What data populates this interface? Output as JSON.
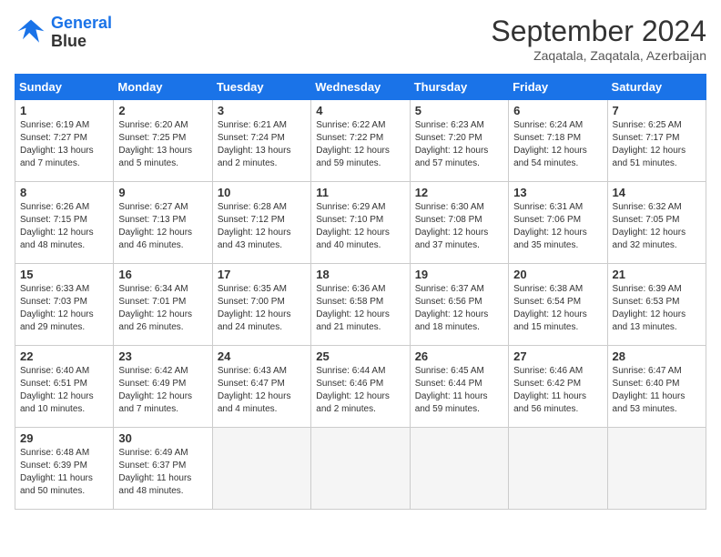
{
  "logo": {
    "line1": "General",
    "line2": "Blue"
  },
  "header": {
    "month": "September 2024",
    "location": "Zaqatala, Zaqatala, Azerbaijan"
  },
  "weekdays": [
    "Sunday",
    "Monday",
    "Tuesday",
    "Wednesday",
    "Thursday",
    "Friday",
    "Saturday"
  ],
  "weeks": [
    [
      {
        "day": "1",
        "info": "Sunrise: 6:19 AM\nSunset: 7:27 PM\nDaylight: 13 hours\nand 7 minutes."
      },
      {
        "day": "2",
        "info": "Sunrise: 6:20 AM\nSunset: 7:25 PM\nDaylight: 13 hours\nand 5 minutes."
      },
      {
        "day": "3",
        "info": "Sunrise: 6:21 AM\nSunset: 7:24 PM\nDaylight: 13 hours\nand 2 minutes."
      },
      {
        "day": "4",
        "info": "Sunrise: 6:22 AM\nSunset: 7:22 PM\nDaylight: 12 hours\nand 59 minutes."
      },
      {
        "day": "5",
        "info": "Sunrise: 6:23 AM\nSunset: 7:20 PM\nDaylight: 12 hours\nand 57 minutes."
      },
      {
        "day": "6",
        "info": "Sunrise: 6:24 AM\nSunset: 7:18 PM\nDaylight: 12 hours\nand 54 minutes."
      },
      {
        "day": "7",
        "info": "Sunrise: 6:25 AM\nSunset: 7:17 PM\nDaylight: 12 hours\nand 51 minutes."
      }
    ],
    [
      {
        "day": "8",
        "info": "Sunrise: 6:26 AM\nSunset: 7:15 PM\nDaylight: 12 hours\nand 48 minutes."
      },
      {
        "day": "9",
        "info": "Sunrise: 6:27 AM\nSunset: 7:13 PM\nDaylight: 12 hours\nand 46 minutes."
      },
      {
        "day": "10",
        "info": "Sunrise: 6:28 AM\nSunset: 7:12 PM\nDaylight: 12 hours\nand 43 minutes."
      },
      {
        "day": "11",
        "info": "Sunrise: 6:29 AM\nSunset: 7:10 PM\nDaylight: 12 hours\nand 40 minutes."
      },
      {
        "day": "12",
        "info": "Sunrise: 6:30 AM\nSunset: 7:08 PM\nDaylight: 12 hours\nand 37 minutes."
      },
      {
        "day": "13",
        "info": "Sunrise: 6:31 AM\nSunset: 7:06 PM\nDaylight: 12 hours\nand 35 minutes."
      },
      {
        "day": "14",
        "info": "Sunrise: 6:32 AM\nSunset: 7:05 PM\nDaylight: 12 hours\nand 32 minutes."
      }
    ],
    [
      {
        "day": "15",
        "info": "Sunrise: 6:33 AM\nSunset: 7:03 PM\nDaylight: 12 hours\nand 29 minutes."
      },
      {
        "day": "16",
        "info": "Sunrise: 6:34 AM\nSunset: 7:01 PM\nDaylight: 12 hours\nand 26 minutes."
      },
      {
        "day": "17",
        "info": "Sunrise: 6:35 AM\nSunset: 7:00 PM\nDaylight: 12 hours\nand 24 minutes."
      },
      {
        "day": "18",
        "info": "Sunrise: 6:36 AM\nSunset: 6:58 PM\nDaylight: 12 hours\nand 21 minutes."
      },
      {
        "day": "19",
        "info": "Sunrise: 6:37 AM\nSunset: 6:56 PM\nDaylight: 12 hours\nand 18 minutes."
      },
      {
        "day": "20",
        "info": "Sunrise: 6:38 AM\nSunset: 6:54 PM\nDaylight: 12 hours\nand 15 minutes."
      },
      {
        "day": "21",
        "info": "Sunrise: 6:39 AM\nSunset: 6:53 PM\nDaylight: 12 hours\nand 13 minutes."
      }
    ],
    [
      {
        "day": "22",
        "info": "Sunrise: 6:40 AM\nSunset: 6:51 PM\nDaylight: 12 hours\nand 10 minutes."
      },
      {
        "day": "23",
        "info": "Sunrise: 6:42 AM\nSunset: 6:49 PM\nDaylight: 12 hours\nand 7 minutes."
      },
      {
        "day": "24",
        "info": "Sunrise: 6:43 AM\nSunset: 6:47 PM\nDaylight: 12 hours\nand 4 minutes."
      },
      {
        "day": "25",
        "info": "Sunrise: 6:44 AM\nSunset: 6:46 PM\nDaylight: 12 hours\nand 2 minutes."
      },
      {
        "day": "26",
        "info": "Sunrise: 6:45 AM\nSunset: 6:44 PM\nDaylight: 11 hours\nand 59 minutes."
      },
      {
        "day": "27",
        "info": "Sunrise: 6:46 AM\nSunset: 6:42 PM\nDaylight: 11 hours\nand 56 minutes."
      },
      {
        "day": "28",
        "info": "Sunrise: 6:47 AM\nSunset: 6:40 PM\nDaylight: 11 hours\nand 53 minutes."
      }
    ],
    [
      {
        "day": "29",
        "info": "Sunrise: 6:48 AM\nSunset: 6:39 PM\nDaylight: 11 hours\nand 50 minutes."
      },
      {
        "day": "30",
        "info": "Sunrise: 6:49 AM\nSunset: 6:37 PM\nDaylight: 11 hours\nand 48 minutes."
      },
      {
        "day": "",
        "info": ""
      },
      {
        "day": "",
        "info": ""
      },
      {
        "day": "",
        "info": ""
      },
      {
        "day": "",
        "info": ""
      },
      {
        "day": "",
        "info": ""
      }
    ]
  ]
}
